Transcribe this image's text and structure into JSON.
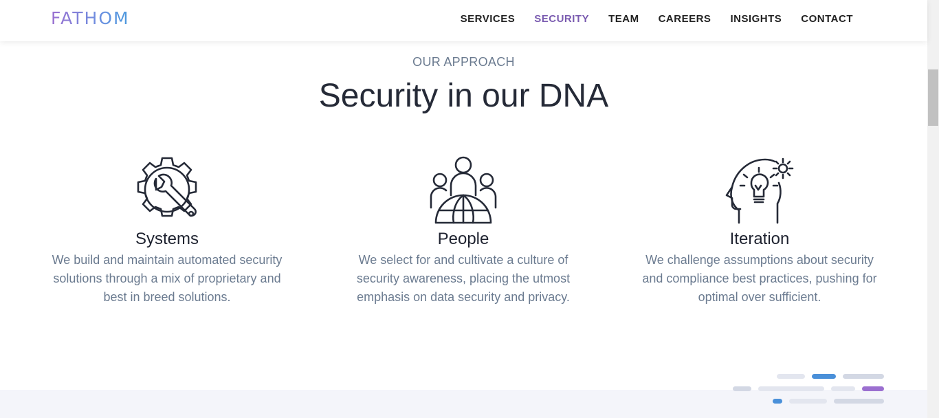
{
  "header": {
    "logo": "FATHOM",
    "nav": [
      {
        "label": "SERVICES"
      },
      {
        "label": "SECURITY"
      },
      {
        "label": "TEAM"
      },
      {
        "label": "CAREERS"
      },
      {
        "label": "INSIGHTS"
      },
      {
        "label": "CONTACT"
      }
    ],
    "active": "SECURITY"
  },
  "section": {
    "eyebrow": "OUR APPROACH",
    "title": "Security in our DNA",
    "columns": [
      {
        "icon": "gear-wrench-icon",
        "title": "Systems",
        "description": "We build and maintain automated security solutions through a mix of proprietary and best in breed solutions."
      },
      {
        "icon": "people-globe-icon",
        "title": "People",
        "description": "We select for and cultivate a culture of security awareness, placing the utmost emphasis on data security and privacy."
      },
      {
        "icon": "head-lightbulb-gear-icon",
        "title": "Iteration",
        "description": "We challenge assumptions about security and compliance best practices, pushing for optimal over sufficient."
      }
    ]
  },
  "colors": {
    "accent": "#7a5bb0",
    "blue": "#4a90d9",
    "text_dark": "#252a37",
    "text_muted": "#6b7b90"
  }
}
